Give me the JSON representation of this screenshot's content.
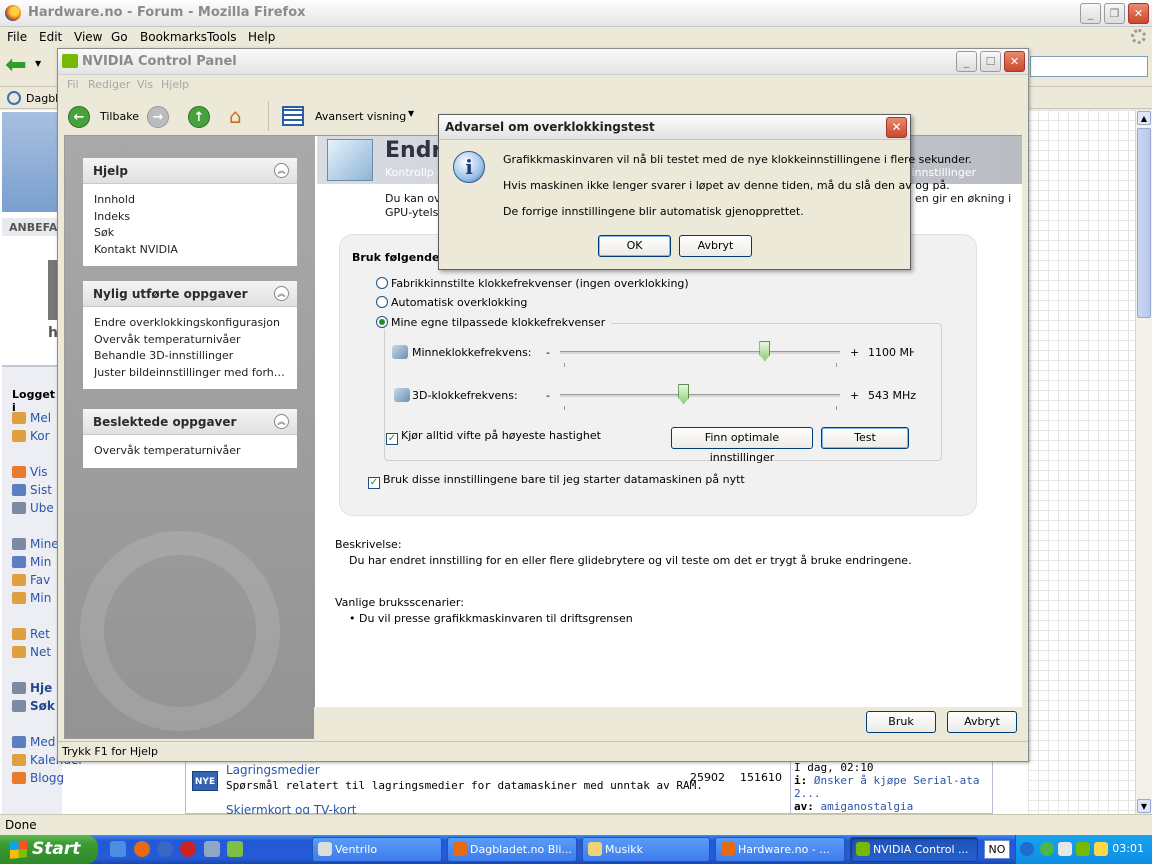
{
  "firefox": {
    "title": "Hardware.no - Forum - Mozilla Firefox",
    "menu": [
      "File",
      "Edit",
      "View",
      "Go",
      "Bookmarks",
      "Tools",
      "Help"
    ],
    "bookmark_label": "Dagbla",
    "status": "Done",
    "left_sidebar": {
      "anbefal": "ANBEFAL",
      "h_char": "h",
      "logged_in": "Logget i",
      "items": [
        "Mel",
        "Kor",
        "Vis",
        "Sist",
        "Ube",
        "Mine",
        "Min",
        "Fav",
        "Min",
        "Ret",
        "Net",
        "Hje",
        "Søk",
        "Med",
        "Kalender",
        "Blogg"
      ]
    },
    "forum_row": {
      "badge": "NYE",
      "title": "Lagringsmedier",
      "description": "Spørsmål relatert til lagringsmedier for datamaskiner med unntak av RAM.",
      "topics": "25902",
      "posts": "151610",
      "last_time": "I dag, 02:10",
      "last_i_label": "i:",
      "last_thread": "Ønsker å kjøpe Serial-ata 2...",
      "last_by_label": "av:",
      "last_author": "amiganostalgia",
      "next_row_title": "Skjermkort og TV-kort"
    }
  },
  "nvidia": {
    "title": "NVIDIA Control Panel",
    "menu": [
      "Fil",
      "Rediger",
      "Vis",
      "Hjelp"
    ],
    "toolbar": {
      "back": "Tilbake",
      "view": "Avansert visning"
    },
    "sidebar": {
      "panels": [
        {
          "title": "Hjelp",
          "items": [
            "Innhold",
            "Indeks",
            "Søk",
            "Kontakt NVIDIA"
          ]
        },
        {
          "title": "Nylig utførte oppgaver",
          "items": [
            "Endre overklokkingskonfigurasjon",
            "Overvåk temperaturnivåer",
            "Behandle 3D-innstillinger",
            "Juster bildeinnstillinger med forhåndsvisning"
          ]
        },
        {
          "title": "Beslektede oppgaver",
          "items": [
            "Overvåk temperaturnivåer"
          ]
        }
      ]
    },
    "banner": {
      "title": "Endr",
      "subtitle": "Kontrollp",
      "right": "innstillinger"
    },
    "intro": {
      "line1": "Du kan ove",
      "line2": "GPU-ytelse",
      "right": "en gir en økning i"
    },
    "settings": {
      "header": "Bruk følgende k",
      "options": [
        {
          "label": "Fabrikkinnstilte klokkefrekvenser (ingen overklokking)",
          "selected": false
        },
        {
          "label": "Automatisk overklokking",
          "selected": false
        },
        {
          "label": "Mine egne tilpassede klokkefrekvenser",
          "selected": true
        }
      ],
      "memory_label": "Minneklokkefrekvens:",
      "memory_value": "1100 MHz",
      "memory_level": 0.73,
      "core_label": "3D-klokkefrekvens:",
      "core_value": "543 MHz",
      "core_level": 0.44,
      "minus": "-",
      "plus": "+",
      "fan_label": "Kjør alltid vifte på høyeste hastighet",
      "fan_checked": true,
      "find_optimal": "Finn optimale innstillinger",
      "test": "Test",
      "persist_label": "Bruk disse innstillingene bare til jeg starter datamaskinen på nytt",
      "persist_checked": true
    },
    "description": {
      "heading": "Beskrivelse:",
      "text": "Du har endret innstilling for en eller flere glidebrytere og vil teste om det er trygt å bruke endringene."
    },
    "usage": {
      "heading": "Vanlige bruksscenarier:",
      "items": [
        "• Du vil presse grafikkmaskinvaren til driftsgrensen"
      ]
    },
    "buttons": {
      "apply": "Bruk",
      "cancel": "Avbryt"
    },
    "status": "Trykk F1 for Hjelp"
  },
  "dialog": {
    "title": "Advarsel om overklokkingstest",
    "line1": "Grafikkmaskinvaren vil nå bli testet med de nye klokkeinnstillingene i flere sekunder.",
    "line2": "Hvis maskinen ikke lenger svarer i løpet av denne tiden, må du slå den av og på.",
    "line3": "De forrige innstillingene blir automatisk gjenopprettet.",
    "ok": "OK",
    "cancel": "Avbryt"
  },
  "taskbar": {
    "start": "Start",
    "tasks": [
      {
        "label": "Ventrilo",
        "active": false
      },
      {
        "label": "Dagbladet.no Bli...",
        "active": false
      },
      {
        "label": "Musikk",
        "active": false
      },
      {
        "label": "Hardware.no - ...",
        "active": false
      },
      {
        "label": "NVIDIA Control ...",
        "active": true
      }
    ],
    "language": "NO",
    "clock": "03:01"
  }
}
